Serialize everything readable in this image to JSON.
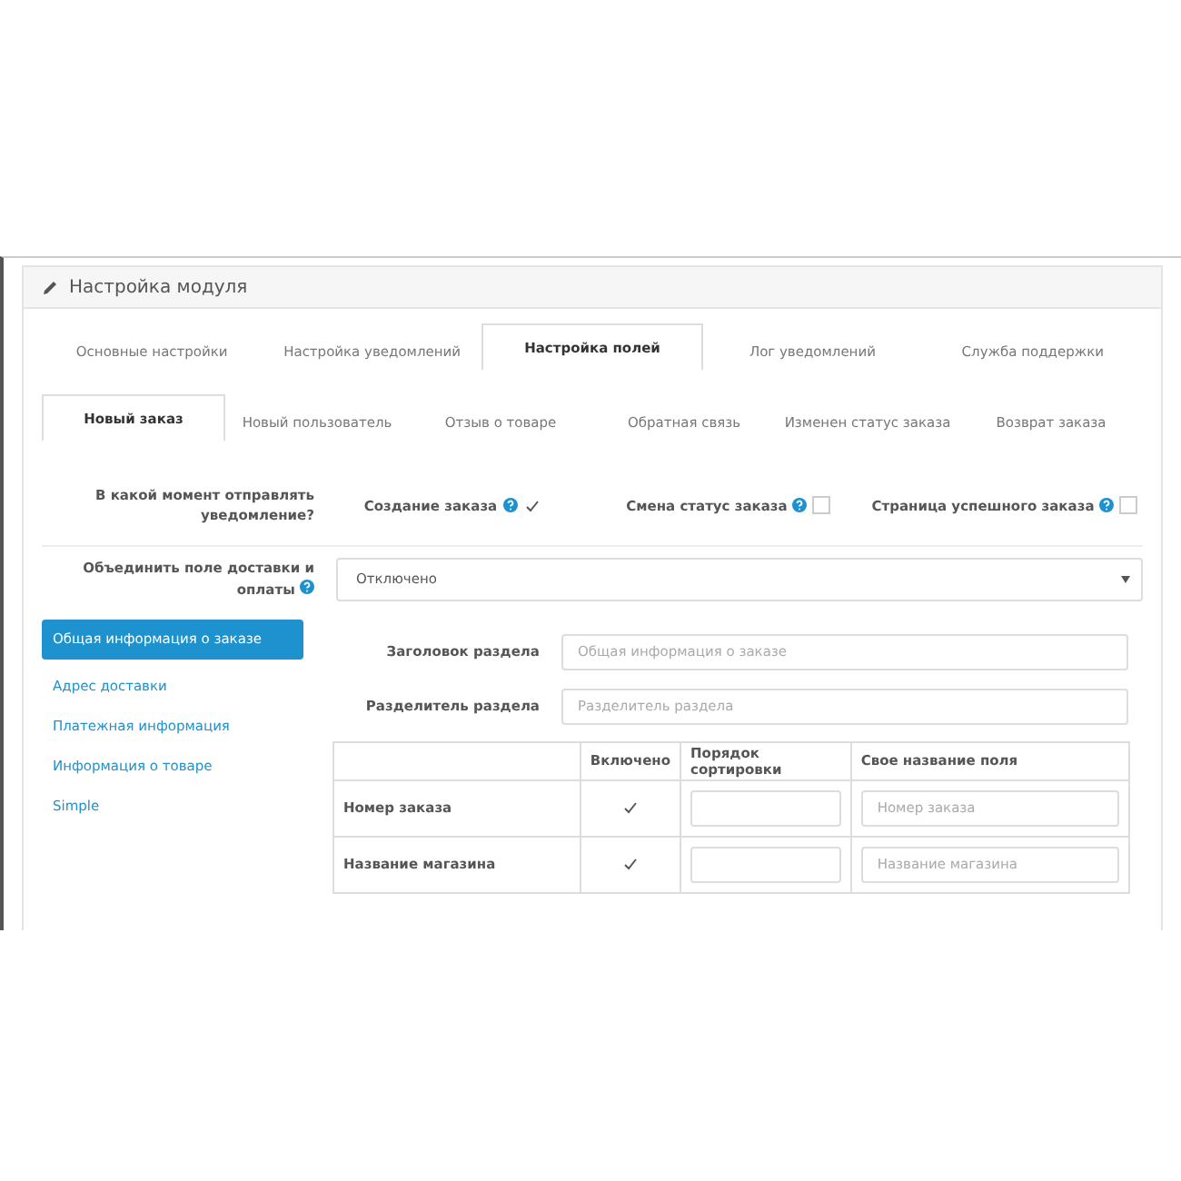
{
  "panel": {
    "title": "Настройка модуля"
  },
  "main_tabs": [
    {
      "label": "Основные настройки",
      "selected": false
    },
    {
      "label": "Настройка уведомлений",
      "selected": false
    },
    {
      "label": "Настройка полей",
      "selected": true
    },
    {
      "label": "Лог уведомлений",
      "selected": false
    },
    {
      "label": "Служба поддержки",
      "selected": false
    }
  ],
  "sub_tabs": [
    {
      "label": "Новый заказ",
      "selected": true
    },
    {
      "label": "Новый пользователь",
      "selected": false
    },
    {
      "label": "Отзыв о товаре",
      "selected": false
    },
    {
      "label": "Обратная связь",
      "selected": false
    },
    {
      "label": "Изменен статус заказа",
      "selected": false
    },
    {
      "label": "Возврат заказа",
      "selected": false
    }
  ],
  "notify_moment": {
    "label": "В какой момент отправлять уведомление?",
    "options": [
      {
        "label": "Создание заказа",
        "checked": true
      },
      {
        "label": "Смена статус заказа",
        "checked": false
      },
      {
        "label": "Страница успешного заказа",
        "checked": false
      }
    ]
  },
  "merge_fields": {
    "label": "Объединить поле доставки и оплаты",
    "value": "Отключено"
  },
  "sections": [
    {
      "label": "Общая информация о заказе",
      "selected": true
    },
    {
      "label": "Адрес доставки",
      "selected": false
    },
    {
      "label": "Платежная информация",
      "selected": false
    },
    {
      "label": "Информация о товаре",
      "selected": false
    },
    {
      "label": "Simple",
      "selected": false
    }
  ],
  "section_title": {
    "label": "Заголовок раздела",
    "placeholder": "Общая информация о заказе"
  },
  "section_separator": {
    "label": "Разделитель раздела",
    "placeholder": "Разделитель раздела"
  },
  "table": {
    "columns": [
      "Включено",
      "Порядок сортировки",
      "Свое название поля"
    ],
    "rows": [
      {
        "name": "Номер заказа",
        "checked": true,
        "placeholder": "Номер заказа"
      },
      {
        "name": "Название магазина",
        "checked": true,
        "placeholder": "Название магазина"
      }
    ]
  }
}
